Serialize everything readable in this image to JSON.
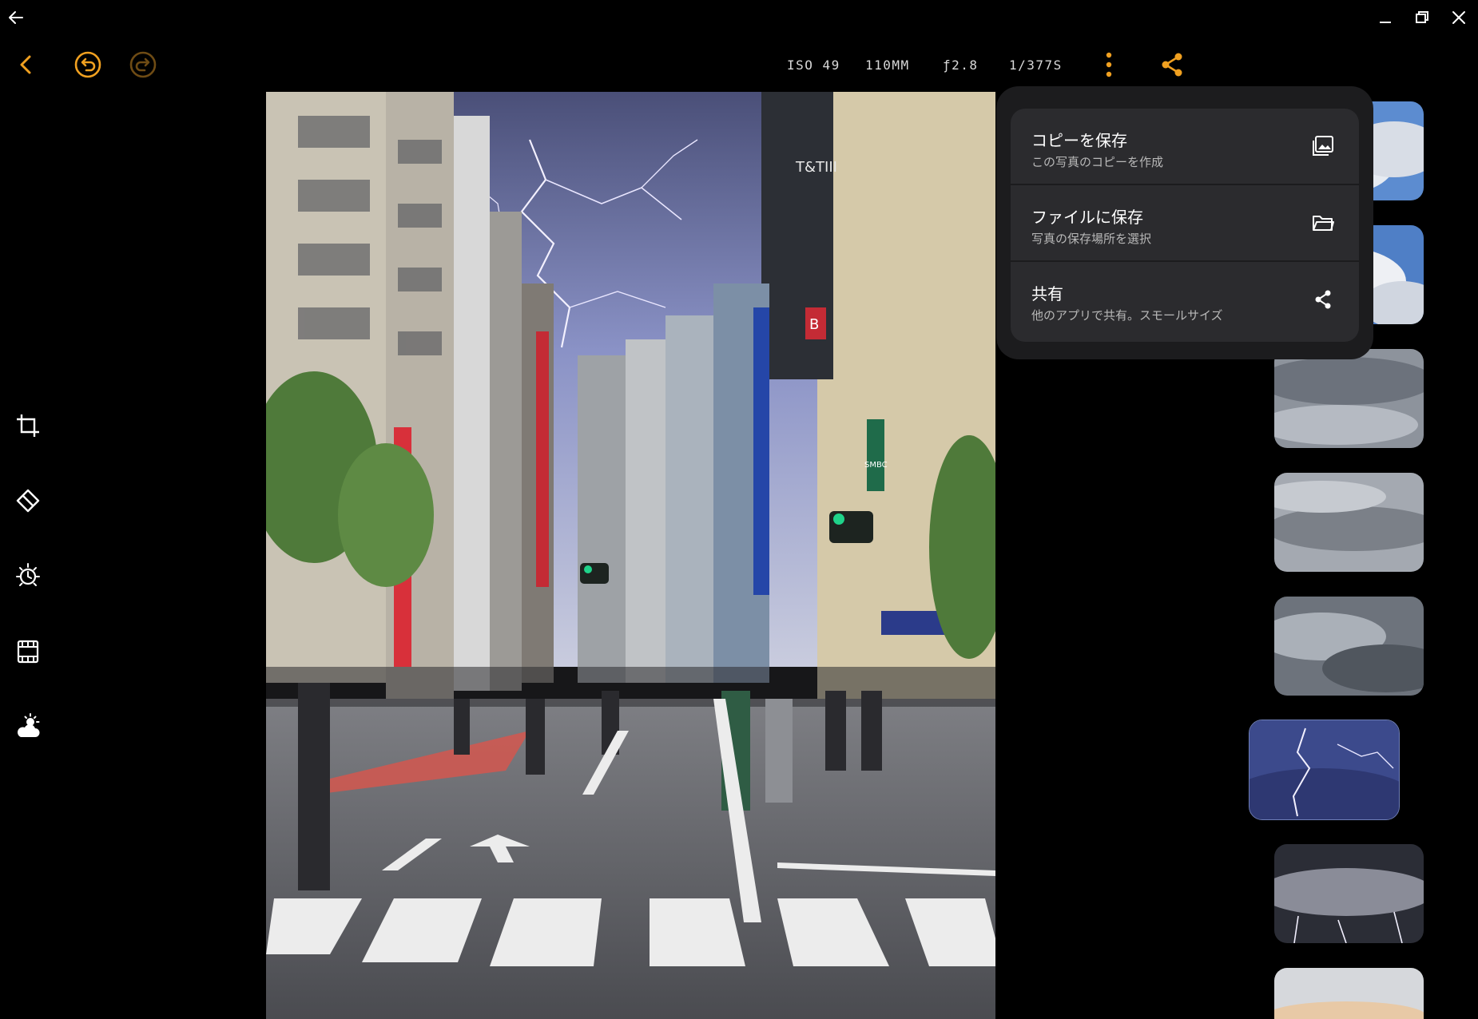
{
  "colors": {
    "accent": "#f0a020",
    "accent_disabled": "#6e4b14",
    "menu_bg": "#1c1c1e",
    "menu_item_bg": "#2b2b2e",
    "meta_text": "#d9d9d9",
    "icon": "#ffffff"
  },
  "window": {
    "icons": [
      "arrow-left-icon",
      "minimize-icon",
      "maximize-icon",
      "close-icon"
    ]
  },
  "toolbar": {
    "icons": [
      "chevron-left-icon",
      "undo-icon",
      "redo-icon",
      "more-vertical-icon",
      "share-icon"
    ],
    "meta": {
      "iso": "ISO 49",
      "focal": "110MM",
      "aperture": "ƒ2.8",
      "shutter": "1/377S"
    }
  },
  "tools": [
    "crop-icon",
    "eraser-icon",
    "exposure-icon",
    "film-icon",
    "weather-icon"
  ],
  "menu": {
    "items": [
      {
        "title": "コピーを保存",
        "subtitle": "この写真のコピーを作成",
        "icon": "image-copy-icon"
      },
      {
        "title": "ファイルに保存",
        "subtitle": "写真の保存場所を選択",
        "icon": "folder-icon"
      },
      {
        "title": "共有",
        "subtitle": "他のアプリで共有。スモールサイズ",
        "icon": "share-icon"
      }
    ]
  },
  "photo": {
    "signs": {
      "building_logo": "T&TIII",
      "smbc": "SMBC",
      "shop_b": "B"
    }
  },
  "sky_thumbnails": {
    "count": 8,
    "selected_index": 6
  }
}
